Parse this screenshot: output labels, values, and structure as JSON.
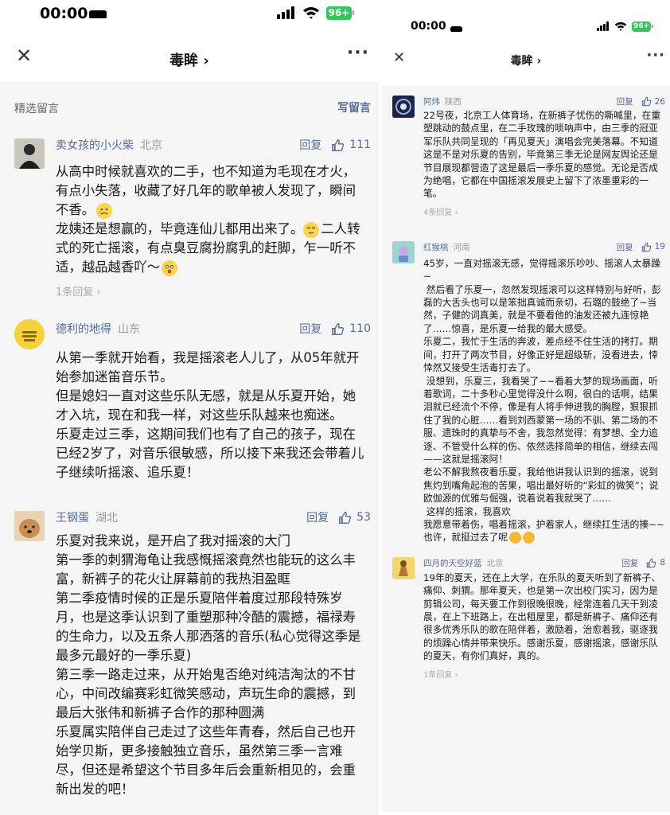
{
  "status_bar": {
    "time": "00:00",
    "battery": "96+"
  },
  "nav": {
    "close": "✕",
    "title": "毒眸 ›",
    "more": "···"
  },
  "section": {
    "label": "精选留言",
    "write": "写留言"
  },
  "colors": {
    "accent": "#576b95",
    "battery": "#34c759",
    "background": "#f5f5f5"
  },
  "left_comments": [
    {
      "name": "卖女孩的小火柴",
      "location": "北京",
      "reply": "回复",
      "likes": "111",
      "lines": [
        "从高中时候就喜欢的二手，也不知道为毛现在才火，有点小失落，收藏了好几年的歌单被人发现了，瞬间不香。"
      ],
      "line2": "龙姨还是想赢的，毕竟连仙儿都用出来了。",
      "line3": "二人转式的死亡摇滚，有点臭豆腐扮腐乳的赶脚，乍一听不适，越品越香吖～",
      "replies": "1条回复 ›"
    },
    {
      "name": "德利的地得",
      "location": "山东",
      "reply": "回复",
      "likes": "110",
      "lines": [
        "从第一季就开始看，我是摇滚老人儿了，从05年就开始参加迷笛音乐节。",
        "但是媳妇一直对这些乐队无感，就是从乐夏开始，她才入坑，现在和我一样，对这些乐队越来也痴迷。",
        "乐夏走过三季，这期间我们也有了自己的孩子，现在已经2岁了，对音乐很敏感，所以接下来我还会带着儿子继续听摇滚、追乐夏！"
      ]
    },
    {
      "name": "王钢蛋",
      "location": "湖北",
      "reply": "回复",
      "likes": "53",
      "lines": [
        "乐夏对我来说，是开启了我对摇滚的大门",
        "第一季的刺猬海龟让我感慨摇滚竟然也能玩的这么丰富，新裤子的花火让屏幕前的我热泪盈眶",
        "第二季疫情时候的正是乐夏陪伴着度过那段特殊岁月，也是这季认识到了重塑那种冷酷的震撼，福禄寿的生命力，以及五条人那洒落的音乐(私心觉得这季是最多元最好的一季乐夏)",
        "第三季一路走过来，从开始鬼否绝对纯洁淘汰的不甘心，中间改编赛彩虹微笑感动，声玩生命的震撼，到最后大张伟和新裤子合作的那种圆满",
        "乐夏属实陪伴自己走过了这些年青春，然后自己也开始学贝斯，更多接触独立音乐，虽然第三季一言难尽，但还是希望这个节目多年后会重新相见的，会重新出发的吧！"
      ]
    }
  ],
  "right_comments": [
    {
      "name": "阿炜",
      "location": "陕西",
      "reply": "回复",
      "likes": "26",
      "lines": [
        "22号夜，北京工人体育场，在新裤子忧伤的嘶喊里，在重塑跳动的鼓点里，在二手玫瑰的唢呐声中，由三季的冠亚军乐队共同呈现的「再见夏天」演唱会完美落幕。不知道这是不是对乐夏的告别，毕竟第三季无论是网友舆论还是节目展现都营造了这是最后一季乐夏的感觉。无论是否成为绝唱，它都在中国摇滚发展史上留下了浓墨重彩的一笔。"
      ],
      "replies": "4条回复 ›"
    },
    {
      "name": "红猴桃",
      "location": "河南",
      "reply": "回复",
      "likes": "19",
      "lines": [
        "45岁，一直对摇滚无感，觉得摇滚乐吵吵、摇滚人太暴躁~",
        " 然后看了乐夏一，忽然发现摇滚可以这样特别与好听，彭磊的大舌头也可以是笨拙真诚而亲切，石璐的鼓绝了~当然，子健的词真美，就是不要看他的油发还被九连惊艳了……惊喜，是乐夏一给我的最大感受。",
        "乐夏二，我忙于生活的奔波，差点经不住生活的拷打。期间，打开了两次节目，好像正好是超级斩，没看进去，悻悻然又接受生活毒打去了。",
        " 没想到，乐夏三，我看哭了~~看着大梦的现场画面，听着歌词，二十多秒心里觉得没什么啊，很白的话啊，结果泪就已经流个不停，像是有人将手伸进我的胸膛，狠狠抓住了我的心脏……看到刘西蒙第一场的不驯、第二场的不服、遗珠时的真挚与不舍，我忽然觉得：有梦想、全力追逐、不管受什么样的伤、依然选择简单的相信，继续去闯——这就是摇滚阿！",
        "老公不解我熬夜看乐夏，我给他讲我认识到的摇滚，说到焦灼到嘴角起泡的苦果，唱出最好听的“彩虹的微笑”；说欧伽源的优雅与倔强，说着说着我就哭了……",
        " 这样的摇滚，我喜欢",
        "我愿意带着伤，唱着摇滚，护着家人，继续扛生活的揍~~"
      ],
      "last_line": "也许，就挺过去了呢"
    },
    {
      "name": "四月的天空好蓝",
      "location": "北京",
      "reply": "回复",
      "likes": "8",
      "lines": [
        "19年的夏天，还在上大学，在乐队的夏天听到了新裤子、痛仰、刺猬。那年夏天，也是第一次出校门实习，因为是剪辑公司，每天要工作到很晚很晚，经常连着几天干到凌晨，在上下班路上，在出租屋里，都是新裤子、痛仰还有很多优秀乐队的歌在陪伴着，激励着，治愈着我，驱逐我的烦躁心情并带来快乐。感谢乐夏，感谢摇滚，感谢乐队的夏天，有你们真好，真的。"
      ],
      "replies": "1条回复 ›"
    }
  ]
}
